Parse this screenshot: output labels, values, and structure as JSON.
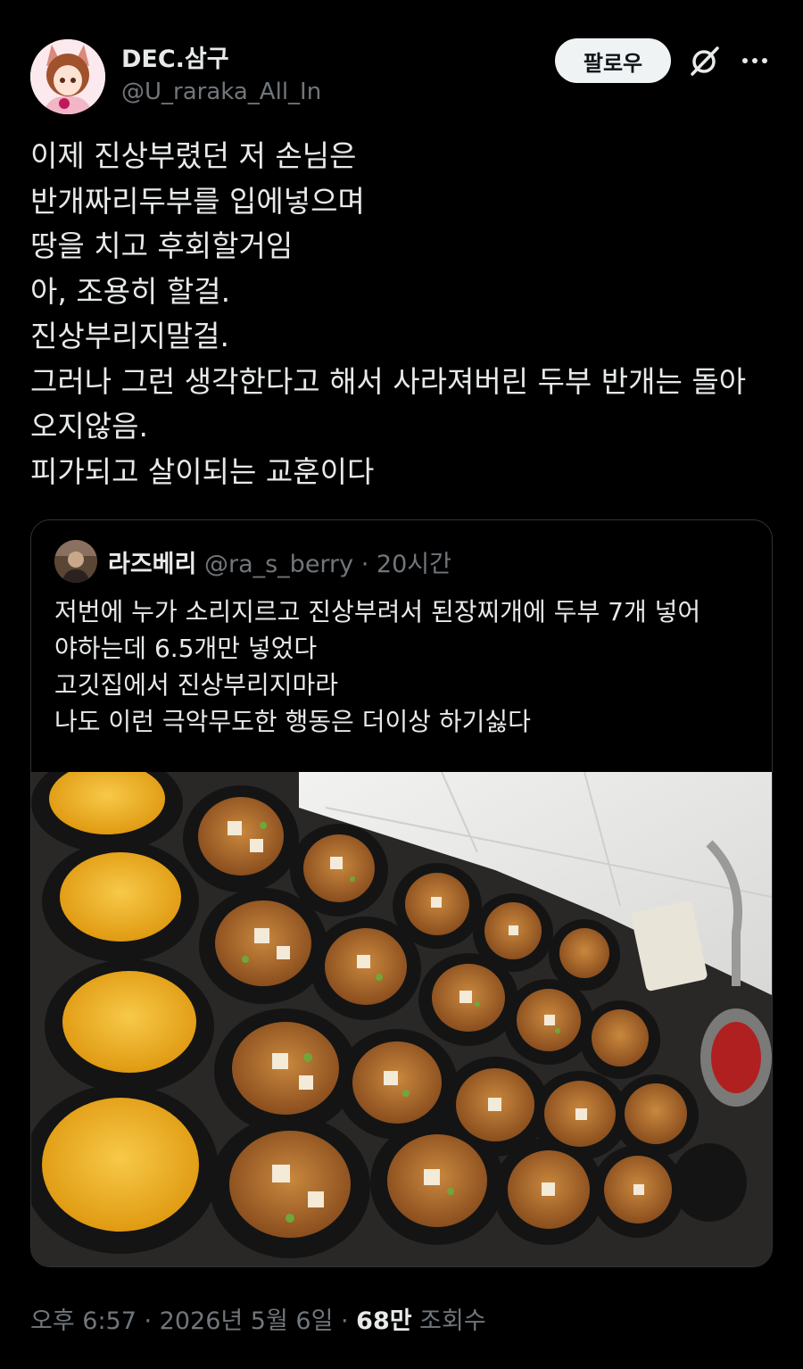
{
  "author": {
    "name": "DEC.삼구",
    "handle": "@U_raraka_All_In"
  },
  "actions": {
    "follow_label": "팔로우",
    "grok_icon": "grok-icon",
    "more_icon": "more-icon"
  },
  "tweet": {
    "lines": [
      "이제 진상부렸던 저 손님은",
      "반개짜리두부를 입에넣으며",
      "땅을 치고 후회할거임",
      "아, 조용히 할걸.",
      "진상부리지말걸.",
      "그러나 그런 생각한다고 해서 사라져버린 두부 반개는 돌아",
      "오지않음.",
      "피가되고 살이되는 교훈이다"
    ]
  },
  "quote": {
    "name": "라즈베리",
    "handle": "@ra_s_berry",
    "dot": "·",
    "time": "20시간",
    "lines": [
      "저번에 누가 소리지르고 진상부려서 된장찌개에 두부 7개 넣어",
      "야하는데 6.5개만 넣었다",
      "고깃집에서 진상부리지마라",
      "나도 이런 극악무도한 행동은 더이상 하기싫다"
    ]
  },
  "meta": {
    "time": "오후 6:57",
    "sep1": " · ",
    "date": "2026년 5월 6일",
    "sep2": " · ",
    "views_count": "68만",
    "views_label": " 조회수"
  },
  "colors": {
    "background": "#000000",
    "text": "#e7e9ea",
    "secondary": "#71767b",
    "border": "#2f3336",
    "follow_bg": "#eff3f4"
  }
}
